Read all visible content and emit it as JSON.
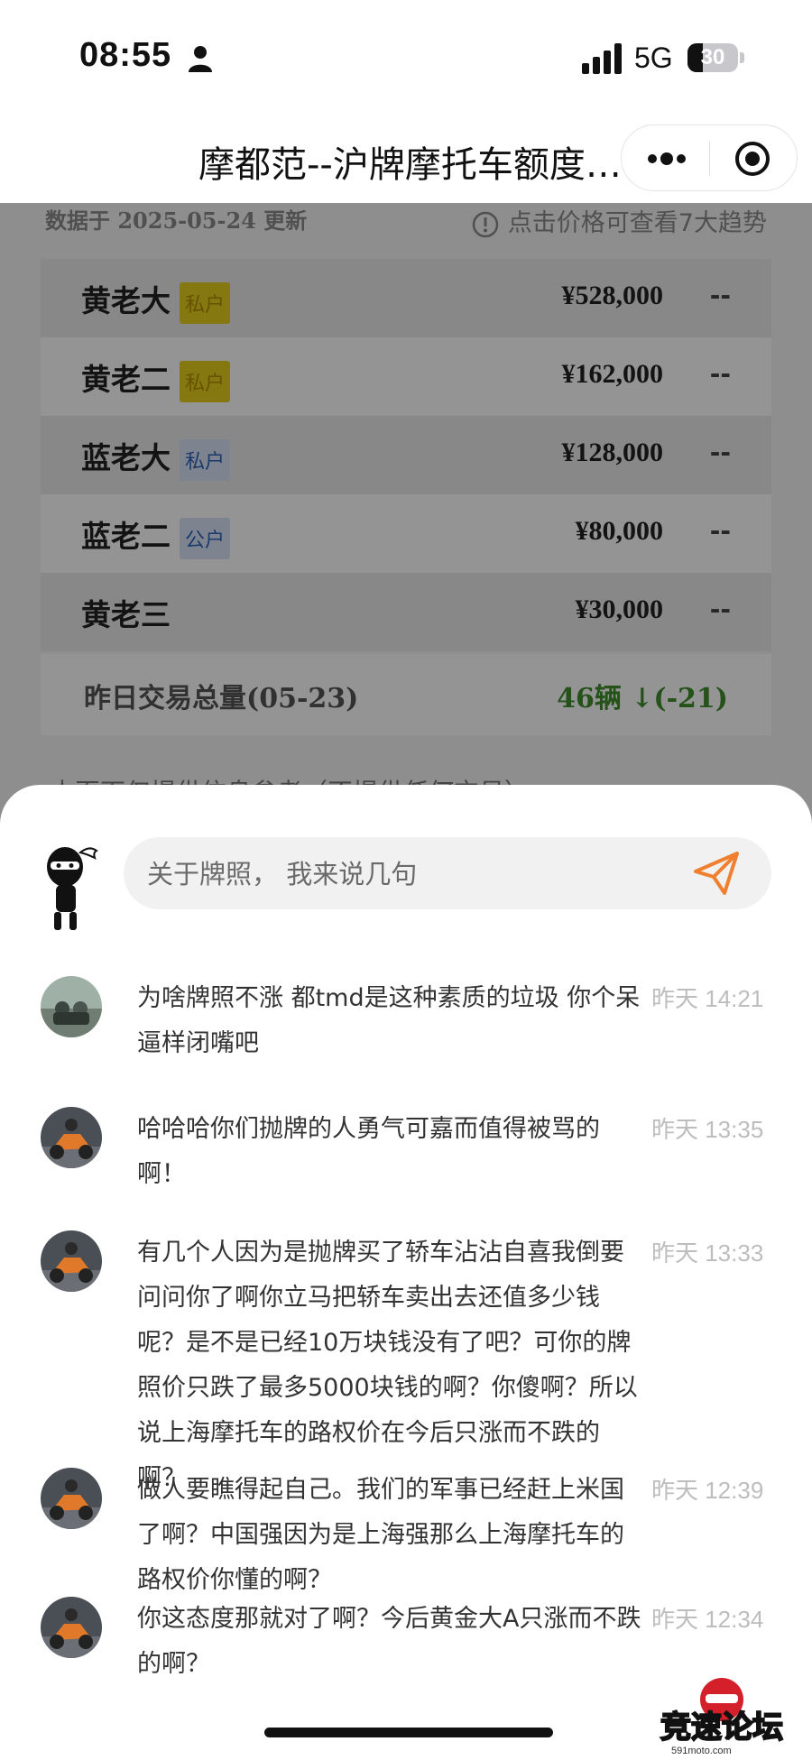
{
  "status_bar": {
    "time": "08:55",
    "network": "5G",
    "battery_level": "30",
    "icons": [
      "person-icon",
      "signal-icon",
      "battery-icon"
    ]
  },
  "nav": {
    "title": "摩都范--沪牌摩托车额度…",
    "icons": [
      "more-icon",
      "target-icon"
    ]
  },
  "page": {
    "update_line": "数据于 2025-05-24 更新",
    "hint": "点击价格可查看7大趋势",
    "rows": [
      {
        "name": "黄老大",
        "tag": "私户",
        "price": "¥528,000",
        "trend": "--",
        "tag_color": "#e6cf1e",
        "tag_text_color": "#b09000"
      },
      {
        "name": "黄老二",
        "tag": "私户",
        "price": "¥162,000",
        "trend": "--",
        "tag_color": "#e6cf1e",
        "tag_text_color": "#b09000"
      },
      {
        "name": "蓝老大",
        "tag": "私户",
        "price": "¥128,000",
        "trend": "--",
        "tag_color": "#d7e4f7",
        "tag_text_color": "#2f63b8"
      },
      {
        "name": "蓝老二",
        "tag": "公户",
        "price": "¥80,000",
        "trend": "--",
        "tag_color": "#d7e4f7",
        "tag_text_color": "#2f63b8"
      },
      {
        "name": "黄老三",
        "tag": "",
        "price": "¥30,000",
        "trend": "--"
      }
    ],
    "volume_label": "昨日交易总量(05-23)",
    "volume_value": "46辆 ↓(-21)",
    "volume_color": "#3e8e2a",
    "disclaimer": "本页面仅提供信息参考（不提供任何交易）"
  },
  "comment_box": {
    "placeholder": "关于牌照， 我来说几句",
    "send_icon": "send-icon",
    "accent": "#f08030"
  },
  "comments": [
    {
      "text": "为啥牌照不涨 都tmd是这种素质的垃圾 你个呆逼样闭嘴吧",
      "time": "昨天 14:21"
    },
    {
      "text": "哈哈哈你们抛牌的人勇气可嘉而值得被骂的啊！",
      "time": "昨天 13:35"
    },
    {
      "text": "有几个人因为是抛牌买了轿车沾沾自喜我倒要问问你了啊你立马把轿车卖出去还值多少钱呢？是不是已经10万块钱没有了吧？可你的牌照价只跌了最多5000块钱的啊？你傻啊？所以说上海摩托车的路权价在今后只涨而不跌的啊？",
      "time": "昨天 13:33"
    },
    {
      "text": "做人要瞧得起自己。我们的军事已经赶上米国了啊？中国强因为是上海强那么上海摩托车的路权价你懂的啊？",
      "time": "昨天 12:39"
    },
    {
      "text": "你这态度那就对了啊？今后黄金大A只涨而不跌的啊？",
      "time": "昨天 12:34"
    }
  ],
  "watermark": {
    "brand_text": "竞速论坛",
    "site": "591moto.com"
  }
}
